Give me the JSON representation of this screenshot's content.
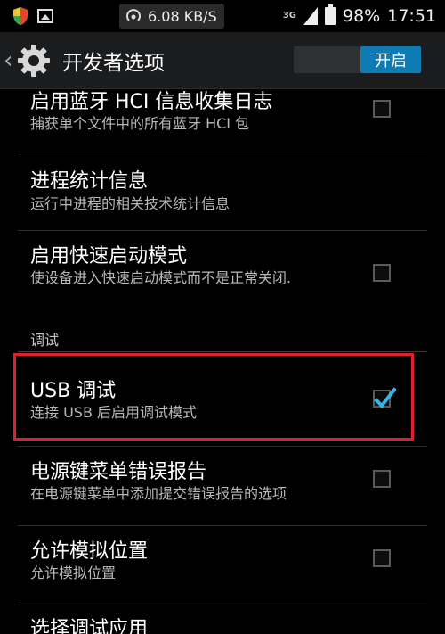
{
  "status_bar": {
    "network_speed": "6.08 KB/S",
    "signal_label": "3G",
    "battery_percent": "98%",
    "time": "17:51",
    "icons": [
      "shield-icon",
      "gallery-icon",
      "hotspot-icon",
      "signal-icon",
      "battery-icon"
    ]
  },
  "action_bar": {
    "title": "开发者选项",
    "toggle_label": "开启",
    "accent": "#0f7bb5"
  },
  "items": [
    {
      "title": "启用蓝牙 HCI 信息收集日志",
      "subtitle": "捕获单个文件中的所有蓝牙 HCI 包",
      "checked": false
    },
    {
      "title": "进程统计信息",
      "subtitle": "运行中进程的相关技术统计信息"
    },
    {
      "title": "启用快速启动模式",
      "subtitle": "使设备进入快速启动模式而不是正常关闭.",
      "checked": false
    },
    {
      "title": "USB 调试",
      "subtitle": "连接 USB 后启用调试模式",
      "checked": true
    },
    {
      "title": "电源键菜单错误报告",
      "subtitle": "在电源键菜单中添加提交错误报告的选项",
      "checked": false
    },
    {
      "title": "允许模拟位置",
      "subtitle": "允许模拟位置",
      "checked": false
    },
    {
      "title": "选择调试应用"
    }
  ],
  "section_debug": "调试",
  "highlight_color": "#e0202a"
}
